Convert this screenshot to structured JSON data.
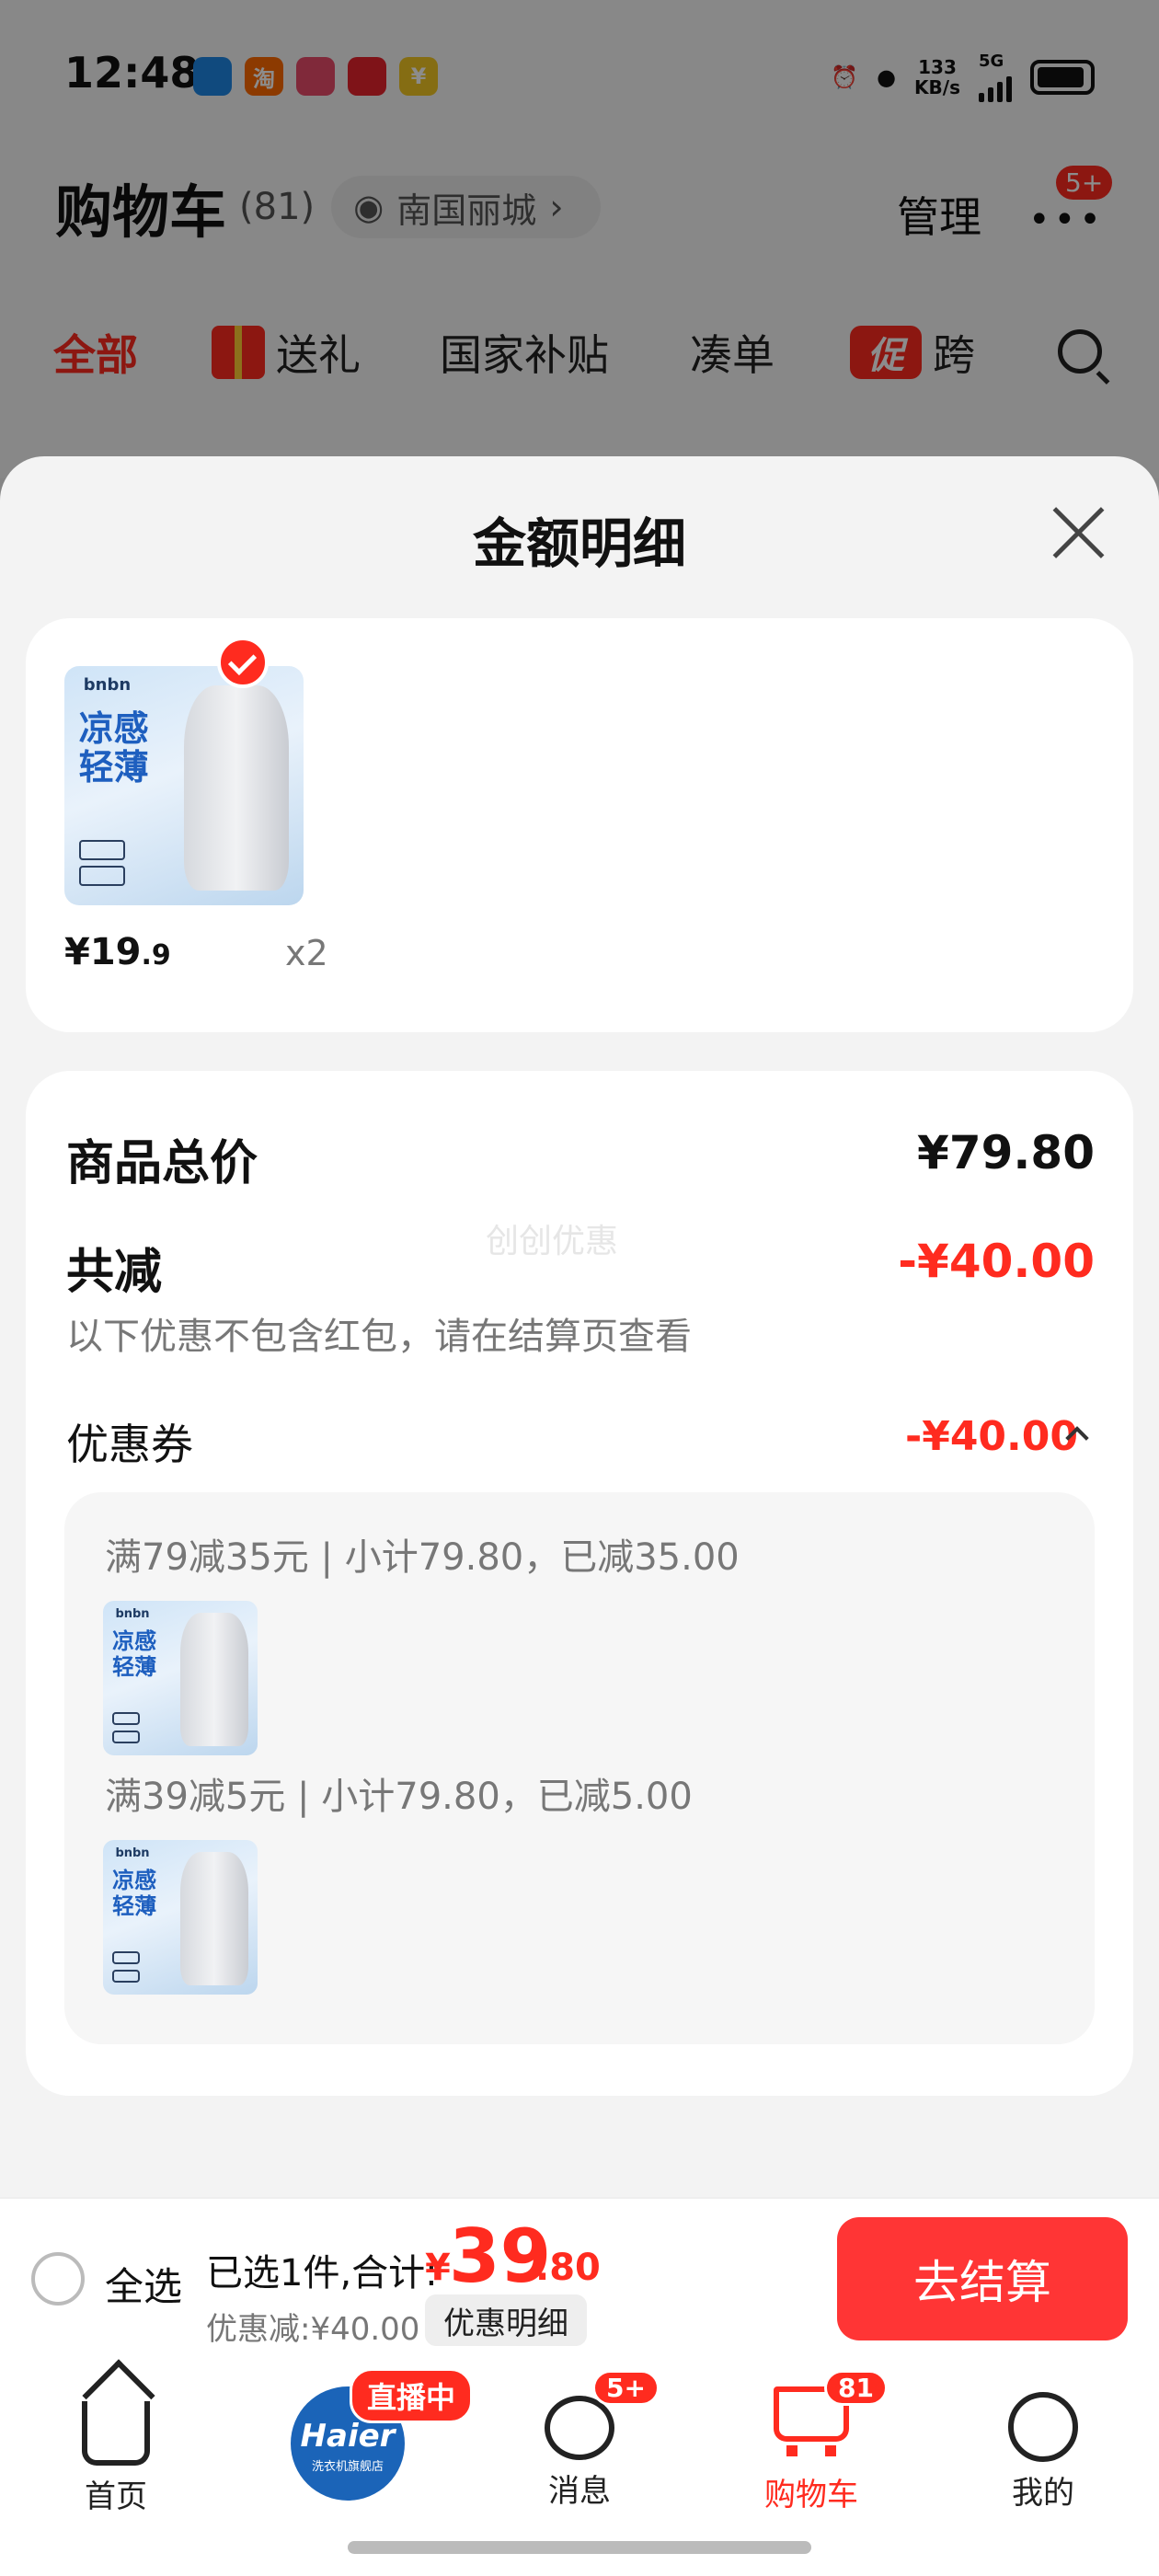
{
  "status_bar": {
    "time": "12:48",
    "app_icons": [
      {
        "name": "app-icon-blue",
        "glyph": "",
        "color": "#1e88e5"
      },
      {
        "name": "taobao-icon",
        "glyph": "淘",
        "color": "#ff6a00"
      },
      {
        "name": "app-icon-pink",
        "glyph": "",
        "color": "#e94b6a"
      },
      {
        "name": "app-icon-red",
        "glyph": "",
        "color": "#e8232d"
      },
      {
        "name": "yuan-icon",
        "glyph": "¥",
        "color": "#f3c623"
      }
    ],
    "net_speed_value": "133",
    "net_speed_unit": "KB/s",
    "network": "5G"
  },
  "header": {
    "title": "购物车",
    "count": "(81)",
    "location": "南国丽城",
    "manage_label": "管理",
    "more_badge": "5+"
  },
  "tabs": [
    {
      "label": "全部",
      "active": true
    },
    {
      "label": "送礼",
      "icon": "gift-icon"
    },
    {
      "label": "国家补贴"
    },
    {
      "label": "凑单"
    },
    {
      "label": "跨",
      "tag": "促"
    }
  ],
  "sheet": {
    "title": "金额明细",
    "item": {
      "thumb_brand": "bnbn",
      "thumb_text_1": "凉感",
      "thumb_text_2": "轻薄",
      "price_int": "¥19",
      "price_dec": ".9",
      "quantity": "x2"
    },
    "total_label": "商品总价",
    "total_value": "¥79.80",
    "reduce_label": "共减",
    "reduce_value": "-¥40.00",
    "note": "以下优惠不包含红包，请在结算页查看",
    "watermark": "创创优惠",
    "coupon_label": "优惠券",
    "coupon_value": "-¥40.00",
    "coupons": [
      {
        "rule": "满79减35元 | 小计79.80，已减35.00"
      },
      {
        "rule": "满39减5元 | 小计79.80，已减5.00"
      }
    ]
  },
  "checkout": {
    "select_all_label": "全选",
    "summary_label": "已选1件,合计:",
    "total_symbol": "¥",
    "total_int": "39",
    "total_dec": ".80",
    "discount_text": "优惠减:¥40.00",
    "detail_button": "优惠明细",
    "checkout_button": "去结算"
  },
  "tabbar": {
    "home": "首页",
    "live_brand": "Haier",
    "live_sub": "洗衣机旗舰店",
    "live_badge": "直播中",
    "messages": "消息",
    "messages_badge": "5+",
    "cart": "购物车",
    "cart_badge": "81",
    "me": "我的"
  },
  "colors": {
    "accent": "#ff2b1f",
    "checkout_button": "#ff3535"
  }
}
